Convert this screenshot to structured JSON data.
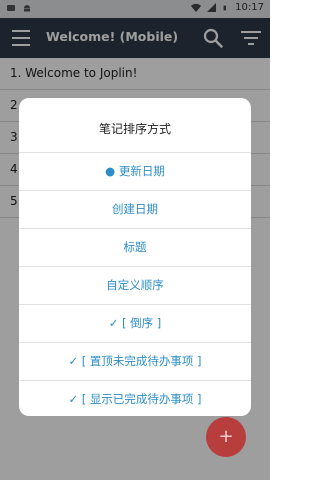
{
  "status_bar": {
    "time": "10:17",
    "icons": [
      "notification-icon",
      "android-icon",
      "wifi-icon",
      "signal-icon",
      "battery-icon"
    ]
  },
  "header": {
    "title": "Welcome! (Mobile)",
    "icons": [
      "hamburger-menu-icon",
      "search-icon",
      "sort-icon"
    ],
    "background_color": "#303947"
  },
  "notes": [
    "1. Welcome to Joplin!",
    "2",
    "3",
    "4",
    "5"
  ],
  "dialog": {
    "title": "笔记排序方式",
    "options": [
      "● 更新日期",
      "创建日期",
      "标题",
      "自定义顺序",
      "✓ [ 倒序 ]",
      "✓ [ 置顶未完成待办事项 ]",
      "✓ [ 显示已完成待办事项 ]"
    ],
    "accent_color": "#2d8ec7"
  },
  "fab": {
    "label": "+",
    "color": "#b83d3d"
  }
}
